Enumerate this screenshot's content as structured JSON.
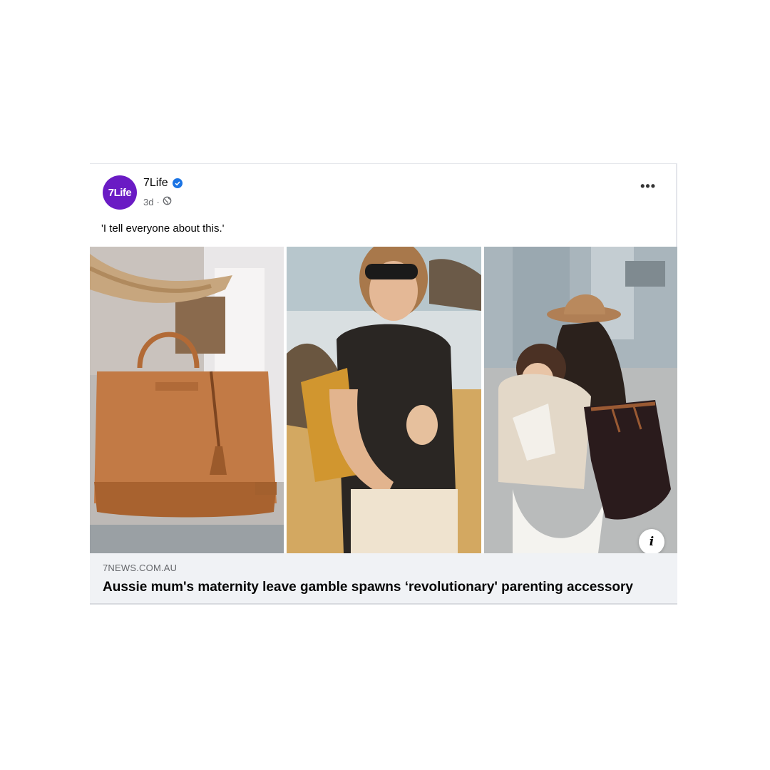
{
  "post": {
    "page_name": "7Life",
    "avatar_text": "7Life",
    "time": "3d",
    "meta_separator": "·",
    "caption": "'I tell everyone about this.'",
    "verified_icon": "verified-badge-icon",
    "privacy_icon": "globe-icon",
    "more_icon": "more-options-icon",
    "more_label": "•••"
  },
  "link": {
    "domain": "7NEWS.COM.AU",
    "headline": "Aussie mum's maternity leave gamble spawns ‘revolutionary' parenting accessory",
    "info_label": "i"
  },
  "colors": {
    "avatar": "#6a1bc4",
    "verified": "#1b74e4",
    "link_bg": "#f0f2f5"
  }
}
